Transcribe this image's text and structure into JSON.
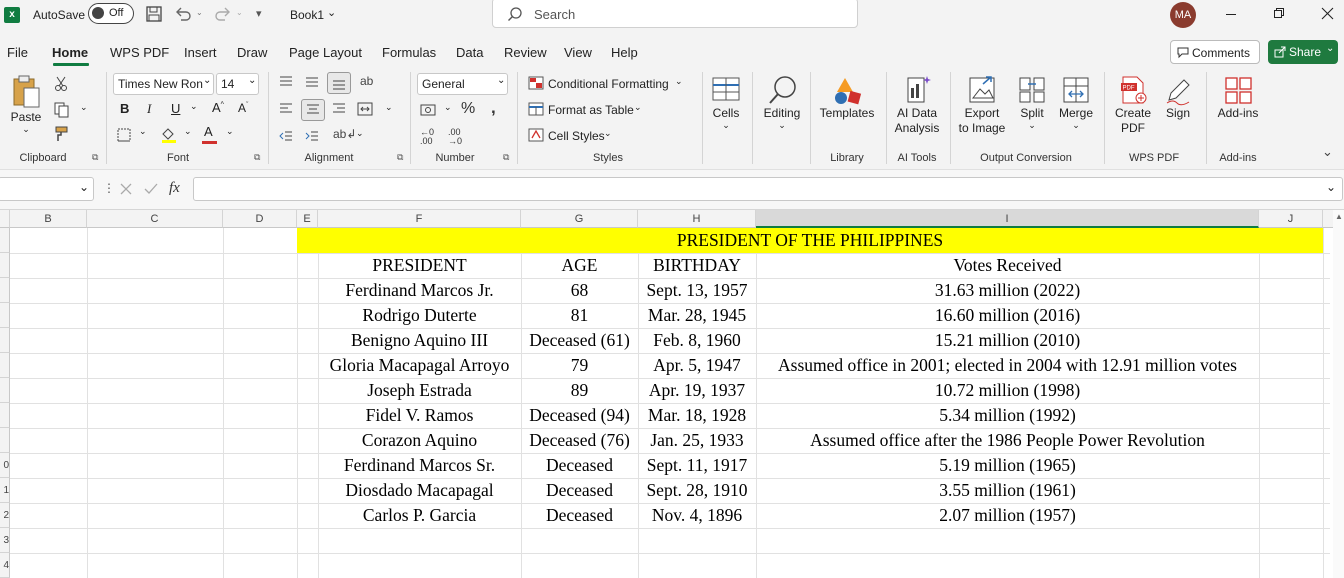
{
  "titlebar": {
    "autosave_label": "AutoSave",
    "autosave_state": "Off",
    "book_title": "Book1",
    "search_placeholder": "Search",
    "user_initials": "MA"
  },
  "menu": {
    "tabs": [
      "File",
      "Home",
      "WPS PDF",
      "Insert",
      "Draw",
      "Page Layout",
      "Formulas",
      "Data",
      "Review",
      "View",
      "Help"
    ],
    "active_tab": "Home",
    "comments_label": "Comments",
    "share_label": "Share"
  },
  "ribbon": {
    "clipboard": {
      "paste": "Paste",
      "group": "Clipboard"
    },
    "font": {
      "name": "Times New Ron",
      "size": "14",
      "group": "Font"
    },
    "alignment": {
      "group": "Alignment"
    },
    "number": {
      "format": "General",
      "group": "Number"
    },
    "styles": {
      "conditional": "Conditional Formatting",
      "format_table": "Format as Table",
      "cell_styles": "Cell Styles",
      "group": "Styles"
    },
    "cells": {
      "label": "Cells"
    },
    "editing": {
      "label": "Editing"
    },
    "library": {
      "templates": "Templates",
      "group": "Library"
    },
    "ai": {
      "analysis_line1": "AI Data",
      "analysis_line2": "Analysis",
      "group": "AI Tools"
    },
    "output": {
      "export_line1": "Export",
      "export_line2": "to Image",
      "split": "Split",
      "merge": "Merge",
      "group": "Output Conversion"
    },
    "wps": {
      "create_line1": "Create",
      "create_line2": "PDF",
      "sign": "Sign",
      "group": "WPS PDF"
    },
    "addins": {
      "label": "Add-ins",
      "group": "Add-ins"
    }
  },
  "formula_bar": {
    "fx": "fx",
    "value": ""
  },
  "sheet": {
    "columns": [
      "B",
      "C",
      "D",
      "E",
      "F",
      "G",
      "H",
      "I",
      "J"
    ],
    "row_numbers": [
      "",
      "",
      "",
      "",
      "",
      "",
      "",
      "",
      "",
      "0",
      "1",
      "2",
      "3",
      "4"
    ],
    "title": "PRESIDENT OF THE PHILIPPINES",
    "header": {
      "president": "PRESIDENT",
      "age": "AGE",
      "birthday": "BIRTHDAY",
      "votes": "Votes Received"
    },
    "rows": [
      {
        "president": "Ferdinand Marcos Jr.",
        "age": "68",
        "birthday": "Sept. 13, 1957",
        "votes": "31.63 million (2022)"
      },
      {
        "president": "Rodrigo Duterte",
        "age": "81",
        "birthday": "Mar. 28, 1945",
        "votes": "16.60 million (2016)"
      },
      {
        "president": "Benigno Aquino III",
        "age": "Deceased (61)",
        "birthday": "Feb. 8, 1960",
        "votes": "15.21 million (2010)"
      },
      {
        "president": "Gloria Macapagal Arroyo",
        "age": "79",
        "birthday": "Apr. 5, 1947",
        "votes": "Assumed office in 2001; elected in 2004 with 12.91 million votes"
      },
      {
        "president": "Joseph Estrada",
        "age": "89",
        "birthday": "Apr. 19, 1937",
        "votes": "10.72 million (1998)"
      },
      {
        "president": "Fidel V. Ramos",
        "age": "Deceased (94)",
        "birthday": "Mar. 18, 1928",
        "votes": "5.34 million (1992)"
      },
      {
        "president": "Corazon Aquino",
        "age": "Deceased (76)",
        "birthday": "Jan. 25, 1933",
        "votes": "Assumed office after the 1986 People Power Revolution"
      },
      {
        "president": "Ferdinand Marcos Sr.",
        "age": "Deceased",
        "birthday": "Sept. 11, 1917",
        "votes": "5.19 million (1965)"
      },
      {
        "president": "Diosdado Macapagal",
        "age": "Deceased",
        "birthday": "Sept. 28, 1910",
        "votes": "3.55 million (1961)"
      },
      {
        "president": "Carlos P. Garcia",
        "age": "Deceased",
        "birthday": "Nov. 4, 1896",
        "votes": "2.07 million (1957)"
      }
    ]
  },
  "colors": {
    "title_fill": "#ffff00",
    "share_green": "#1f7a3f",
    "excel_green": "#107c41",
    "avatar": "#8a3b2e",
    "formatting_red": "#d0312d"
  }
}
